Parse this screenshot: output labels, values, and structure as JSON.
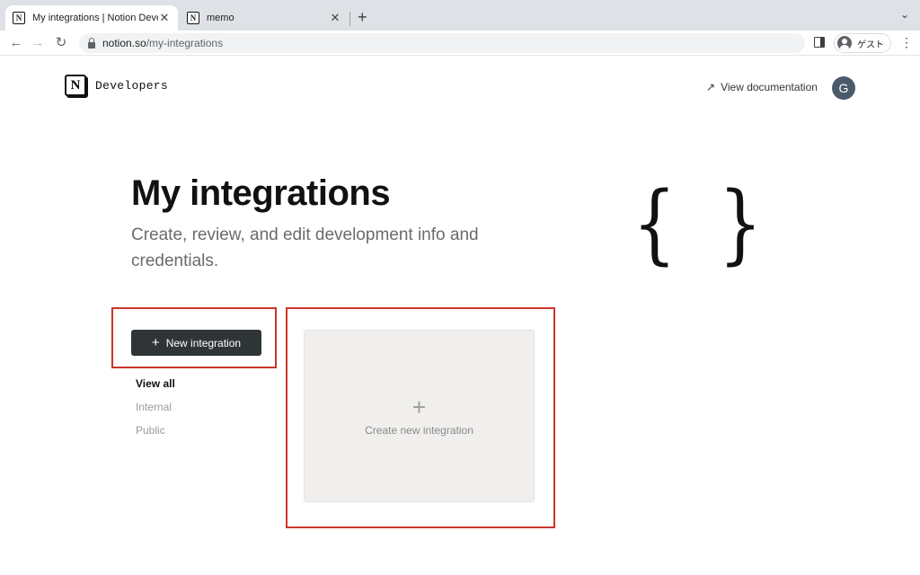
{
  "browser": {
    "tabs": [
      {
        "title": "My integrations | Notion Developers",
        "active": true
      },
      {
        "title": "memo",
        "active": false
      }
    ],
    "url_host": "notion.so",
    "url_path": "/my-integrations",
    "profile_label": "ゲスト"
  },
  "header": {
    "brand_name": "Developers",
    "view_docs_label": "View documentation",
    "avatar_letter": "G"
  },
  "main": {
    "title": "My integrations",
    "subtitle": "Create, review, and edit development info and credentials.",
    "illustration_text": "{ }",
    "new_button_label": "New integration",
    "filters": [
      {
        "label": "View all",
        "active": true
      },
      {
        "label": "Internal",
        "active": false
      },
      {
        "label": "Public",
        "active": false
      }
    ],
    "create_card_label": "Create new integration"
  },
  "colors": {
    "highlight": "#c9372c",
    "primary_button": "#2f3437",
    "card_bg": "#f0efee"
  }
}
